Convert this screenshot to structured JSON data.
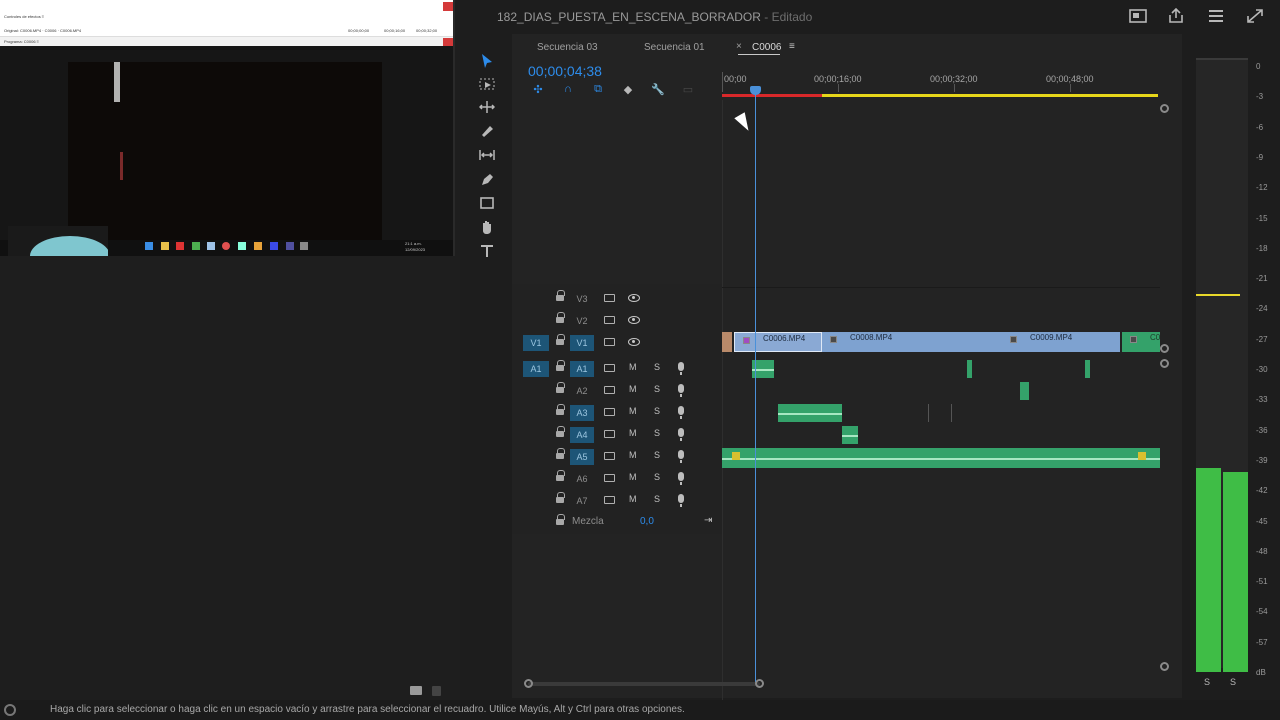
{
  "window": {
    "title": "182_DIAS_PUESTA_EN_ESCENA_BORRADOR",
    "state": "Editado"
  },
  "overlay": {
    "top_text": "Controles de efectos  ≡",
    "top_text2": "Original: C0006.MP4  ·  C0006 · C0006.MP4",
    "program_label": "Programa: C0006  ≡",
    "tc1": "00;00;00;00",
    "tc2": "00;00;16;00",
    "tc3": "00;00;32;00",
    "clock_time": "21:1 a.m.",
    "clock_date": "12/09/2023"
  },
  "tabs": [
    {
      "label": "Secuencia 03"
    },
    {
      "label": "Secuencia 01"
    },
    {
      "label": "C0006",
      "active": true
    }
  ],
  "timeline": {
    "timecode": "00;00;04;38",
    "ruler": [
      "00;00",
      "00;00;16;00",
      "00;00;32;00",
      "00;00;48;00"
    ]
  },
  "video_tracks": [
    {
      "name": "V3"
    },
    {
      "name": "V2"
    },
    {
      "name": "V1",
      "source": "V1"
    }
  ],
  "audio_tracks": [
    {
      "name": "A1",
      "source": "A1"
    },
    {
      "name": "A2"
    },
    {
      "name": "A3"
    },
    {
      "name": "A4"
    },
    {
      "name": "A5"
    },
    {
      "name": "A6"
    },
    {
      "name": "A7"
    }
  ],
  "mix": {
    "label": "Mezcla",
    "value": "0,0"
  },
  "mute_label": "M",
  "solo_label": "S",
  "clips": [
    {
      "name": "C0006.MP4"
    },
    {
      "name": "C0008.MP4"
    },
    {
      "name": "C0009.MP4"
    },
    {
      "name": "C0"
    }
  ],
  "meter": {
    "scale": [
      "0",
      "-3",
      "-6",
      "-9",
      "-12",
      "-15",
      "-18",
      "-21",
      "-24",
      "-27",
      "-30",
      "-33",
      "-36",
      "-39",
      "-42",
      "-45",
      "-48",
      "-51",
      "-54",
      "-57",
      "dB"
    ],
    "solo_left": "S",
    "solo_right": "S"
  },
  "status": {
    "text": "Haga clic para seleccionar o haga clic en un espacio vacío y arrastre para seleccionar el recuadro. Utilice Mayús, Alt y Ctrl para otras opciones."
  },
  "colors": {
    "accent": "#2d8ceb",
    "video_clip": "#7ea2d0",
    "audio_clip": "#34a26a",
    "meter_green": "#3fbd46",
    "workarea_red": "#d8282a",
    "workarea_yellow": "#e6d61a"
  }
}
